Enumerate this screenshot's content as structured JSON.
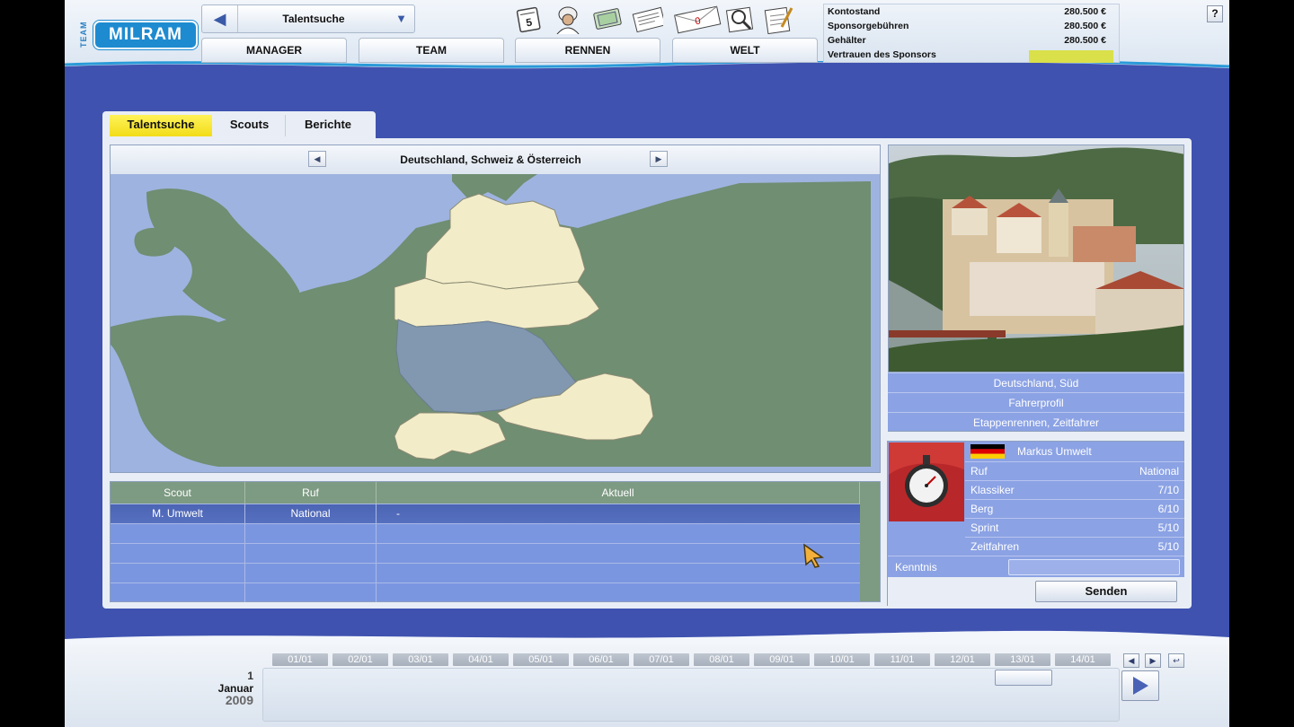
{
  "app": {
    "logo_team": "TEAM",
    "logo_brand": "MILRAM",
    "help_label": "?"
  },
  "nav": {
    "current_screen": "Talentsuche",
    "main_tabs": [
      "MANAGER",
      "TEAM",
      "RENNEN",
      "WELT"
    ]
  },
  "toolbar_icons": [
    "calendar-icon",
    "rider-helmet-icon",
    "money-icon",
    "newspaper-icon",
    "mail-icon",
    "magnifier-icon",
    "notes-icon"
  ],
  "mail_count": "0",
  "calendar_day": "5",
  "finance": {
    "rows": [
      {
        "label": "Kontostand",
        "value": "280.500 €"
      },
      {
        "label": "Sponsorgebühren",
        "value": "280.500 €"
      },
      {
        "label": "Gehälter",
        "value": "280.500 €"
      }
    ],
    "trust_label": "Vertrauen des Sponsors",
    "trust_color": "#d9e04a"
  },
  "panel": {
    "tabs": [
      "Talentsuche",
      "Scouts",
      "Berichte"
    ],
    "active_tab": "Talentsuche",
    "region_title": "Deutschland, Schweiz & Österreich",
    "selected_region": "Deutschland, Süd"
  },
  "scout_table": {
    "headers": [
      "Scout",
      "Ruf",
      "Aktuell"
    ],
    "rows": [
      {
        "scout": "M. Umwelt",
        "ruf": "National",
        "aktuell": "-"
      },
      {
        "scout": "",
        "ruf": "",
        "aktuell": ""
      },
      {
        "scout": "",
        "ruf": "",
        "aktuell": ""
      },
      {
        "scout": "",
        "ruf": "",
        "aktuell": ""
      },
      {
        "scout": "",
        "ruf": "",
        "aktuell": ""
      }
    ]
  },
  "region_info": {
    "name": "Deutschland, Süd",
    "profile_label": "Fahrerprofil",
    "profile_value": "Etappenrennen, Zeitfahrer"
  },
  "scout_profile": {
    "name": "Markus Umwelt",
    "flag": "germany-flag",
    "stats": [
      {
        "label": "Ruf",
        "value": "National"
      },
      {
        "label": "Klassiker",
        "value": "7/10"
      },
      {
        "label": "Berg",
        "value": "6/10"
      },
      {
        "label": "Sprint",
        "value": "5/10"
      },
      {
        "label": "Zeitfahren",
        "value": "5/10"
      }
    ],
    "kenntnis_label": "Kenntnis",
    "kenntnis_level": 0,
    "send_label": "Senden"
  },
  "timeline": {
    "dates": [
      "01/01",
      "02/01",
      "03/01",
      "04/01",
      "05/01",
      "06/01",
      "07/01",
      "08/01",
      "09/01",
      "10/01",
      "11/01",
      "12/01",
      "13/01",
      "14/01"
    ],
    "current_day": "1",
    "current_month": "Januar",
    "current_year": "2009"
  }
}
